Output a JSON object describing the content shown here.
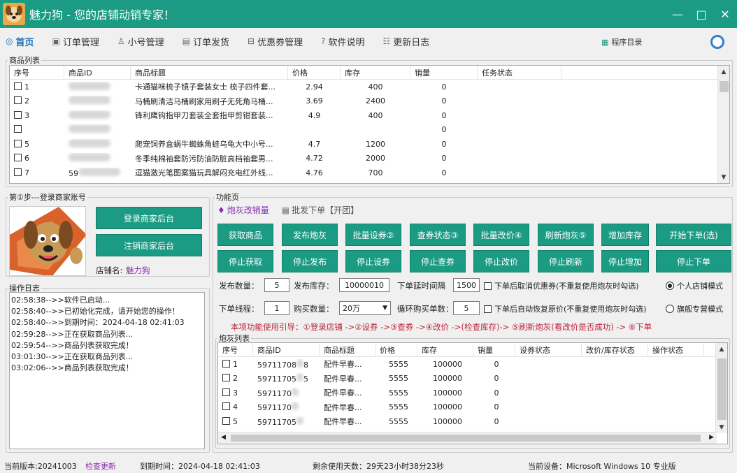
{
  "app": {
    "title": "魅力狗 - 您的店铺动销专家！",
    "window_controls": [
      "—",
      "□",
      "✕"
    ]
  },
  "menu": [
    {
      "label": "首页",
      "icon": "home-icon",
      "active": true
    },
    {
      "label": "订单管理",
      "icon": "order-icon"
    },
    {
      "label": "小号管理",
      "icon": "users-icon"
    },
    {
      "label": "订单发货",
      "icon": "shipping-icon"
    },
    {
      "label": "优惠券管理",
      "icon": "coupon-icon"
    },
    {
      "label": "软件说明",
      "icon": "help-icon"
    },
    {
      "label": "更新日志",
      "icon": "log-icon"
    }
  ],
  "program_dir": "程序目录",
  "product_list": {
    "legend": "商品列表",
    "headers": [
      "序号",
      "商品ID",
      "商品标题",
      "价格",
      "库存",
      "销量",
      "任务状态"
    ],
    "rows": [
      {
        "no": "1",
        "id": "",
        "title": "卡通猫咪梳子镜子套装女士 梳子四件套...",
        "price": "2.94",
        "stock": "400",
        "sales": "0"
      },
      {
        "no": "2",
        "id": "",
        "title": "马桶刷清洁马桶刷家用刷子无死角马桶...",
        "price": "3.69",
        "stock": "2400",
        "sales": "0"
      },
      {
        "no": "3",
        "id": "",
        "title": "锋利鹰钩指甲刀套装全套指甲剪钳套装...",
        "price": "4.9",
        "stock": "400",
        "sales": "0"
      },
      {
        "no": "",
        "id": "",
        "title": "",
        "price": "",
        "stock": "",
        "sales": "0"
      },
      {
        "no": "5",
        "id": "",
        "title": "爬宠饲养盒蜗牛蜘蛛角蛙乌龟大中小号...",
        "price": "4.7",
        "stock": "1200",
        "sales": "0"
      },
      {
        "no": "6",
        "id": "",
        "title": "冬季纯棉袖套防污防油防脏高档袖套男...",
        "price": "4.72",
        "stock": "2000",
        "sales": "0"
      },
      {
        "no": "7",
        "id": "59",
        "title": "逗猫激光笔图案猫玩具解闷充电红外线...",
        "price": "4.76",
        "stock": "700",
        "sales": "0"
      }
    ]
  },
  "login": {
    "legend": "第①步---登录商家账号",
    "login_button": "登录商家后台",
    "logout_button": "注销商家后台",
    "shop_label": "店铺名:",
    "shop_name": "魅力狗"
  },
  "log": {
    "legend": "操作日志",
    "lines": [
      "02:58:38-->>软件已启动...",
      "02:58:40-->>已初始化完成，请开始您的操作！",
      "02:58:40-->>到期时间：2024-04-18 02:41:03",
      "02:59:28-->>正在获取商品列表...",
      "02:59:54-->>商品列表获取完成！",
      "03:01:30-->>正在获取商品列表...",
      "03:02:06-->>商品列表获取完成！"
    ]
  },
  "function": {
    "legend": "功能页",
    "tab1": "炮灰改销量",
    "tab2": "批发下单【开团】",
    "buttons_row1": [
      "获取商品",
      "发布炮灰",
      "批量设券②",
      "查券状态③",
      "批量改价④",
      "刷新炮灰⑤",
      "增加库存",
      "开始下单(选)"
    ],
    "buttons_row2": [
      "停止获取",
      "停止发布",
      "停止设券",
      "停止查券",
      "停止改价",
      "停止刷新",
      "停止增加",
      "停止下单"
    ],
    "publish_qty_label": "发布数量：",
    "publish_qty": "5",
    "publish_stock_label": "发布库存：",
    "publish_stock": "10000010",
    "delay_label": "下单延时间隔",
    "delay": "1500",
    "chk_cancel_coupon": "下单后取消优惠券(不重复使用炮灰时勾选)",
    "radio_personal": "个人店铺模式",
    "threads_label": "下单线程：",
    "threads": "1",
    "buy_qty_label": "购买数量：",
    "buy_qty": "20万",
    "loop_label": "循环购买单数：",
    "loop": "5",
    "chk_restore_price": "下单后自动恢复原价(不重复使用炮灰时勾选)",
    "radio_flagship": "旗舰专营模式",
    "guide": "本项功能使用引导：①登录店铺 ->②设券 ->③查券 ->④改价 ->(检查库存)-> ⑤刷新炮灰(看改价是否成功) -> ⑥下单"
  },
  "cannon_list": {
    "legend": "炮灰列表",
    "headers": [
      "序号",
      "商品ID",
      "商品标题",
      "价格",
      "库存",
      "销量",
      "设券状态",
      "改价/库存状态",
      "操作状态"
    ],
    "rows": [
      {
        "no": "1",
        "id": "59711708",
        "id_tail": "8",
        "title": "配件早春...",
        "price": "5555",
        "stock": "100000",
        "sales": "0"
      },
      {
        "no": "2",
        "id": "59711705",
        "id_tail": "5",
        "title": "配件早春...",
        "price": "5555",
        "stock": "100000",
        "sales": "0"
      },
      {
        "no": "3",
        "id": "5971170",
        "id_tail": "",
        "title": "配件早春...",
        "price": "5555",
        "stock": "100000",
        "sales": "0"
      },
      {
        "no": "4",
        "id": "5971170",
        "id_tail": "",
        "title": "配件早春...",
        "price": "5555",
        "stock": "100000",
        "sales": "0"
      },
      {
        "no": "5",
        "id": "59711705",
        "id_tail": "",
        "title": "配件早春...",
        "price": "5555",
        "stock": "100000",
        "sales": "0"
      }
    ]
  },
  "status": {
    "version": "当前版本:20241003",
    "check_update": "检查更新",
    "expire": "到期时间：2024-04-18 02:41:03",
    "remaining": "剩余使用天数：29天23小时38分23秒",
    "device": "当前设备：Microsoft Windows 10 专业版"
  },
  "colors": {
    "teal": "#1b9b83",
    "guide_red": "#c0203a",
    "link_purple": "#8a2bb5",
    "accent_blue": "#1b6fb5"
  }
}
